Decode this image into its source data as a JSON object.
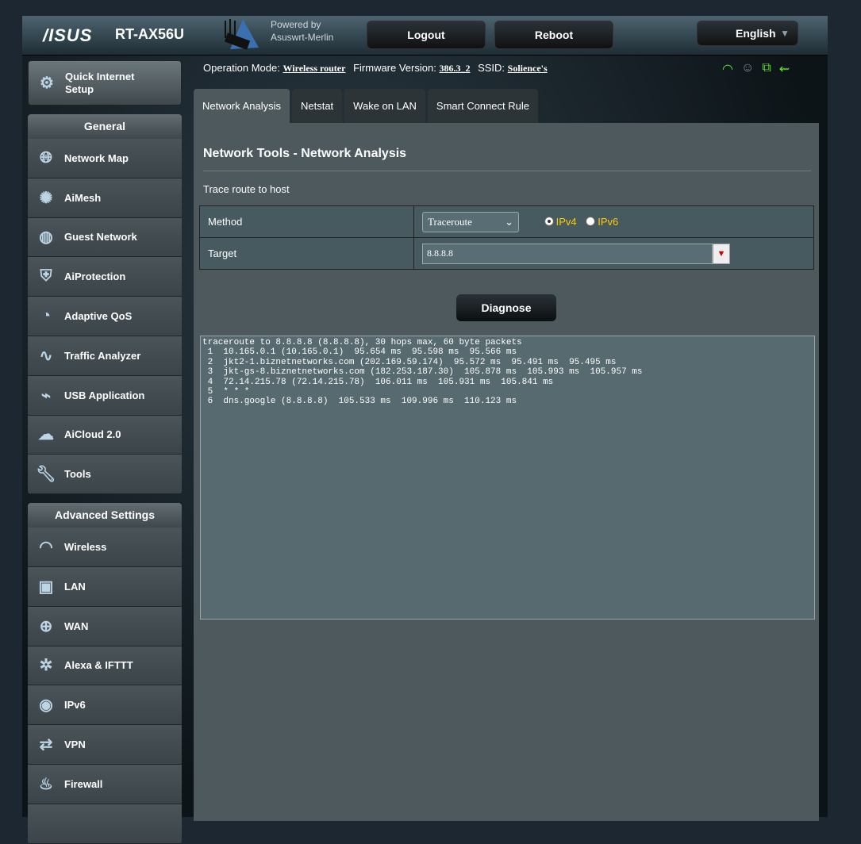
{
  "header": {
    "brand": "/ISUS",
    "model": "RT-AX56U",
    "powered_by": "Powered by",
    "firmware_name": "Asuswrt-Merlin",
    "logout": "Logout",
    "reboot": "Reboot",
    "language": "English"
  },
  "info": {
    "op_mode_label": "Operation Mode:",
    "op_mode": "Wireless router",
    "fw_label": "Firmware Version:",
    "fw": "386.3_2",
    "ssid_label": "SSID:",
    "ssid": "Solience's"
  },
  "sidebar": {
    "quick_setup": "Quick Internet Setup",
    "general_title": "General",
    "general": [
      "Network Map",
      "AiMesh",
      "Guest Network",
      "AiProtection",
      "Adaptive QoS",
      "Traffic Analyzer",
      "USB Application",
      "AiCloud 2.0",
      "Tools"
    ],
    "advanced_title": "Advanced Settings",
    "advanced": [
      "Wireless",
      "LAN",
      "WAN",
      "Alexa & IFTTT",
      "IPv6",
      "VPN",
      "Firewall"
    ]
  },
  "tabs": [
    "Network Analysis",
    "Netstat",
    "Wake on LAN",
    "Smart Connect Rule"
  ],
  "main": {
    "title": "Network Tools - Network Analysis",
    "subtitle": "Trace route to host",
    "method_label": "Method",
    "method": "Traceroute",
    "ipv4": "IPv4",
    "ipv6": "IPv6",
    "target_label": "Target",
    "target": "8.8.8.8",
    "diagnose": "Diagnose",
    "output": "traceroute to 8.8.8.8 (8.8.8.8), 30 hops max, 60 byte packets\n 1  10.165.0.1 (10.165.0.1)  95.654 ms  95.598 ms  95.566 ms\n 2  jkt2-1.biznetnetworks.com (202.169.59.174)  95.572 ms  95.491 ms  95.495 ms\n 3  jkt-gs-8.biznetnetworks.com (182.253.187.30)  105.878 ms  105.993 ms  105.957 ms\n 4  72.14.215.78 (72.14.215.78)  106.011 ms  105.931 ms  105.841 ms\n 5  * * *\n 6  dns.google (8.8.8.8)  105.533 ms  109.996 ms  110.123 ms"
  }
}
